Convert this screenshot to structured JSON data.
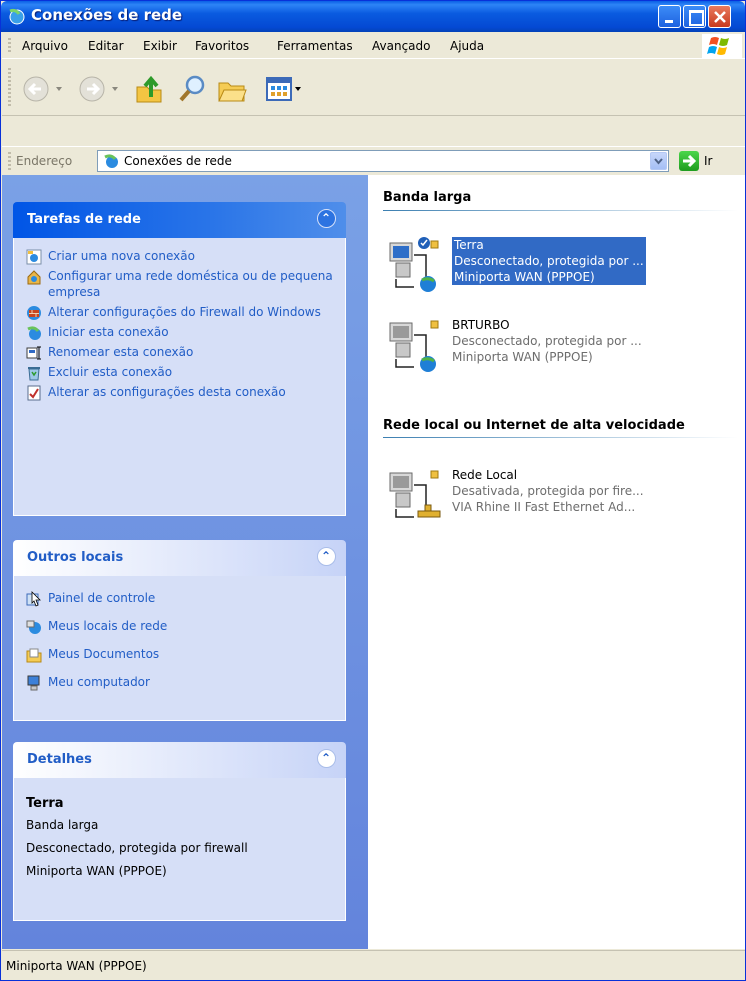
{
  "window": {
    "title": "Conexões de rede"
  },
  "menu": [
    {
      "label": "Arquivo"
    },
    {
      "label": "Editar"
    },
    {
      "label": "Exibir"
    },
    {
      "label": "Favoritos"
    },
    {
      "label": "Ferramentas"
    },
    {
      "label": "Avançado"
    },
    {
      "label": "Ajuda"
    }
  ],
  "address": {
    "label": "Endereço",
    "value": "Conexões de rede",
    "go_label": "Ir"
  },
  "left": {
    "tasks_panel": {
      "title": "Tarefas de rede",
      "items": [
        {
          "label": "Criar uma nova conexão",
          "icon": "new-connection-icon"
        },
        {
          "label": "Configurar uma rede doméstica ou de pequena empresa",
          "icon": "home-network-icon"
        },
        {
          "label": "Alterar configurações do Firewall do Windows",
          "icon": "firewall-icon"
        },
        {
          "label": "Iniciar esta conexão",
          "icon": "start-connection-icon"
        },
        {
          "label": "Renomear esta conexão",
          "icon": "rename-icon"
        },
        {
          "label": "Excluir esta conexão",
          "icon": "delete-icon"
        },
        {
          "label": "Alterar as configurações desta conexão",
          "icon": "properties-icon"
        }
      ]
    },
    "places_panel": {
      "title": "Outros locais",
      "items": [
        {
          "label": "Painel de controle",
          "icon": "control-panel-icon"
        },
        {
          "label": "Meus locais de rede",
          "icon": "network-places-icon"
        },
        {
          "label": "Meus Documentos",
          "icon": "my-documents-icon"
        },
        {
          "label": "Meu computador",
          "icon": "my-computer-icon"
        }
      ]
    },
    "details_panel": {
      "title": "Detalhes",
      "name": "Terra",
      "lines": [
        "Banda larga",
        "Desconectado, protegida por firewall",
        "Miniporta WAN (PPPOE)"
      ]
    }
  },
  "groups": [
    {
      "title": "Banda larga",
      "connections": [
        {
          "name": "Terra",
          "status": "Desconectado, protegida por ...",
          "device": "Miniporta WAN (PPPOE)",
          "selected": true
        },
        {
          "name": "BRTURBO",
          "status": "Desconectado, protegida por ...",
          "device": "Miniporta WAN (PPPOE)",
          "selected": false
        }
      ]
    },
    {
      "title": "Rede local ou Internet de alta velocidade",
      "connections": [
        {
          "name": "Rede Local",
          "status": "Desativada, protegida por fire...",
          "device": "VIA Rhine II Fast Ethernet Ad...",
          "selected": false
        }
      ]
    }
  ],
  "status_bar": {
    "text": "Miniporta WAN (PPPOE)"
  },
  "colors": {
    "title_bar": "#0a5be0",
    "link": "#215dc6",
    "selection": "#316ac5",
    "left_pane": "#6f93e0"
  }
}
